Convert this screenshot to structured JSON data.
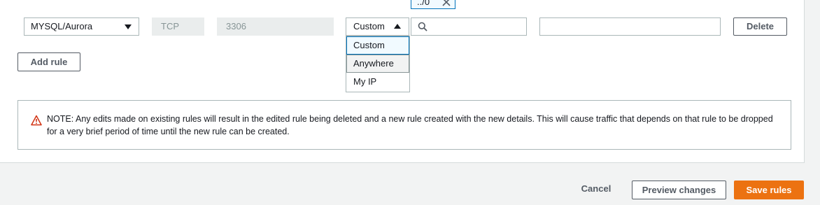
{
  "rule": {
    "type_value": "MYSQL/Aurora",
    "protocol_value": "TCP",
    "port_value": "3306",
    "source_value": "Custom",
    "cidr_value": "",
    "description_value": "",
    "tag_chip_text": "../0",
    "delete_label": "Delete"
  },
  "source_dropdown": {
    "options": [
      "Custom",
      "Anywhere",
      "My IP"
    ],
    "selected": "Custom",
    "hovered": "Anywhere"
  },
  "add_rule_label": "Add rule",
  "note": {
    "text": "NOTE: Any edits made on existing rules will result in the edited rule being deleted and a new rule created with the new details. This will cause traffic that depends on that rule to be dropped for a very brief period of time until the new rule can be created."
  },
  "footer": {
    "cancel_label": "Cancel",
    "preview_label": "Preview changes",
    "save_label": "Save rules"
  },
  "colors": {
    "accent": "#ec7211",
    "selection_border": "#0073bb",
    "warning": "#d13212"
  },
  "icons": {
    "type_select": "caret-down-icon",
    "source_select": "caret-up-icon",
    "tag_chip": "close-icon",
    "cidr_input": "search-icon",
    "note": "warning-icon"
  }
}
